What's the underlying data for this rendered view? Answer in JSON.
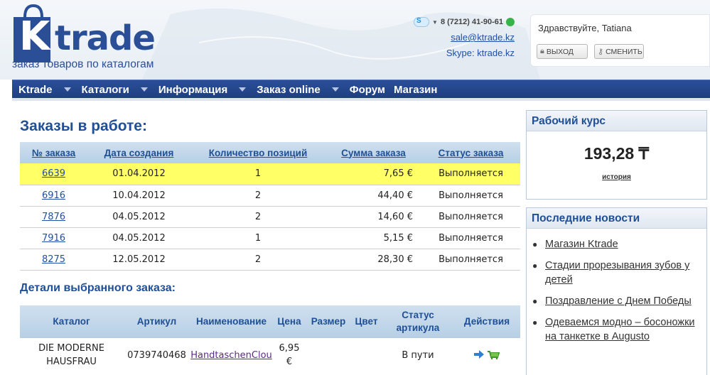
{
  "brand": {
    "logo_k": "K",
    "logo_rest": "trade",
    "tagline": "заказ товаров по каталогам",
    "color": "#2b4f97"
  },
  "contacts": {
    "phone": "8 (7212) 41-90-61",
    "email": "sale@ktrade.kz",
    "skype": "Skype: ktrade.kz"
  },
  "user": {
    "greeting": "Здравствуйте, Tatiana",
    "logout_label": "выход",
    "change_label": "сменить"
  },
  "nav": {
    "items": [
      {
        "label": "Ktrade",
        "has_dropdown": true
      },
      {
        "label": "Каталоги",
        "has_dropdown": true
      },
      {
        "label": "Информация",
        "has_dropdown": true
      },
      {
        "label": "Заказ online",
        "has_dropdown": true
      },
      {
        "label": "Форум",
        "has_dropdown": false
      },
      {
        "label": "Магазин",
        "has_dropdown": false
      }
    ]
  },
  "orders": {
    "title": "Заказы в работе:",
    "columns": [
      "№ заказа",
      "Дата создания",
      "Количество позиций",
      "Сумма заказа",
      "Статус заказа"
    ],
    "rows": [
      {
        "num": "6639",
        "date": "01.04.2012",
        "count": "1",
        "sum": "7,65 €",
        "status": "Выполняется",
        "selected": true
      },
      {
        "num": "6916",
        "date": "10.04.2012",
        "count": "2",
        "sum": "44,40 €",
        "status": "Выполняется",
        "selected": false
      },
      {
        "num": "7876",
        "date": "04.05.2012",
        "count": "2",
        "sum": "14,60 €",
        "status": "Выполняется",
        "selected": false
      },
      {
        "num": "7916",
        "date": "04.05.2012",
        "count": "1",
        "sum": "5,15 €",
        "status": "Выполняется",
        "selected": false
      },
      {
        "num": "8275",
        "date": "12.05.2012",
        "count": "2",
        "sum": "28,30 €",
        "status": "Выполняется",
        "selected": false
      }
    ],
    "highlight_color": "#ffff66"
  },
  "details": {
    "title": "Детали выбранного заказа:",
    "columns": [
      "Каталог",
      "Артикул",
      "Наименование",
      "Цена",
      "Размер",
      "Цвет",
      "Статус артикула",
      "Действия"
    ],
    "rows": [
      {
        "catalog": "DIE MODERNE HAUSFRAU",
        "article": "0739740468",
        "name": "HandtaschenClou",
        "price": "6,95 €",
        "size": "",
        "color": "",
        "status": "В пути",
        "actions": [
          "arrow-right-icon",
          "cart-icon"
        ]
      }
    ]
  },
  "sidebar": {
    "rate": {
      "title": "Рабочий курс",
      "value": "193,28 ₸",
      "history_label": "история"
    },
    "news": {
      "title": "Последние новости",
      "items": [
        "Магазин Ktrade",
        "Стадии прорезывания зубов у детей",
        "Поздравление с Днем Победы",
        "Одеваемся модно – босоножки на танкетке в Augusto"
      ]
    }
  }
}
